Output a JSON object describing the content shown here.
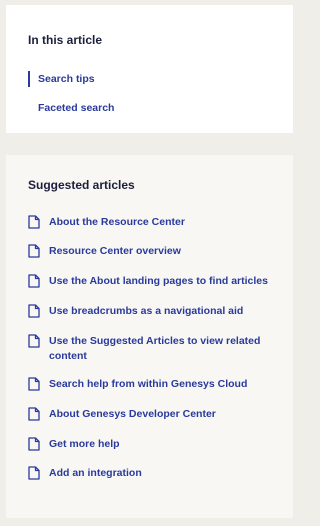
{
  "toc": {
    "title": "In this article",
    "items": [
      {
        "label": "Search tips",
        "active": true
      },
      {
        "label": "Faceted search",
        "active": false
      }
    ]
  },
  "suggested": {
    "title": "Suggested articles",
    "icon": "document-icon",
    "items": [
      {
        "label": "About the Resource Center"
      },
      {
        "label": "Resource Center overview"
      },
      {
        "label": "Use the About landing pages to find articles"
      },
      {
        "label": "Use breadcrumbs as a navigational aid"
      },
      {
        "label": "Use the Suggested Articles to view related content"
      },
      {
        "label": "Search help from within Genesys Cloud"
      },
      {
        "label": "About Genesys Developer Center"
      },
      {
        "label": "Get more help"
      },
      {
        "label": "Add an integration"
      }
    ]
  },
  "colors": {
    "link": "#2a3a9c",
    "heading": "#1c1f3c",
    "background": "#efeee9"
  }
}
